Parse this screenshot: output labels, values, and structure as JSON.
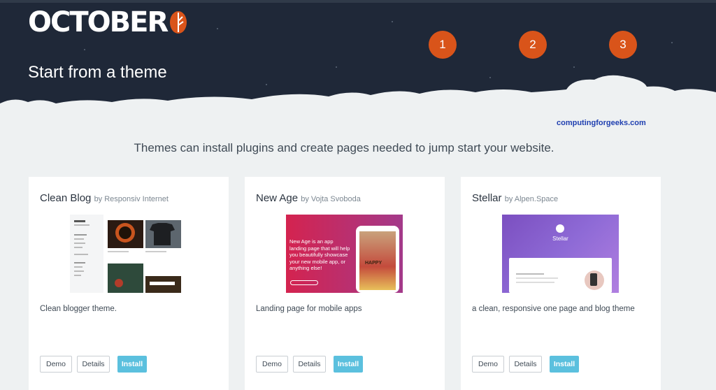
{
  "app": {
    "logo_text": "OCTOBER",
    "page_title": "Start from a theme",
    "steps": [
      "1",
      "2",
      "3"
    ]
  },
  "watermark": "computingforgeeks.com",
  "subtitle": "Themes can install plugins and create pages needed to jump start your website.",
  "themes": [
    {
      "name": "Clean Blog",
      "author": "by Responsiv Internet",
      "description": "Clean blogger theme.",
      "buttons": {
        "demo": "Demo",
        "details": "Details",
        "install": "Install"
      }
    },
    {
      "name": "New Age",
      "author": "by Vojta Svoboda",
      "description": "Landing page for mobile apps",
      "preview_text": "New Age is an app landing page that will help you beautifully showcase your new mobile app, or anything else!",
      "preview_phone_text": "HAPPY",
      "buttons": {
        "demo": "Demo",
        "details": "Details",
        "install": "Install"
      }
    },
    {
      "name": "Stellar",
      "author": "by Alpen.Space",
      "description": "a clean, responsive one page and blog theme",
      "preview_text": "Stellar",
      "buttons": {
        "demo": "Demo",
        "details": "Details",
        "install": "Install"
      }
    }
  ],
  "colors": {
    "header_bg": "#1f2838",
    "step_badge": "#d9541a",
    "install_button": "#5bc0de",
    "page_bg": "#eef1f2"
  }
}
